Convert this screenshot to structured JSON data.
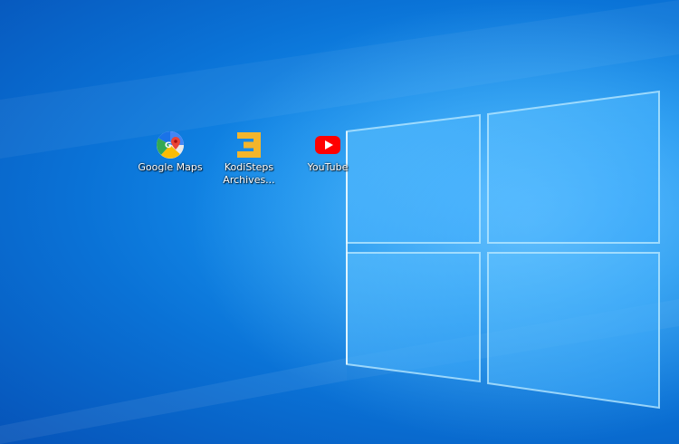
{
  "desktop": {
    "icons": [
      {
        "label": "Google Maps",
        "icon": "google-maps-icon"
      },
      {
        "label": "KodiSteps\nArchives...",
        "icon": "kodisteps-icon"
      },
      {
        "label": "YouTube",
        "icon": "youtube-icon"
      }
    ]
  },
  "colors": {
    "wallpaper_blue": "#0a72d6",
    "kodisteps_orange": "#f3b52c",
    "youtube_red": "#ff0000"
  }
}
